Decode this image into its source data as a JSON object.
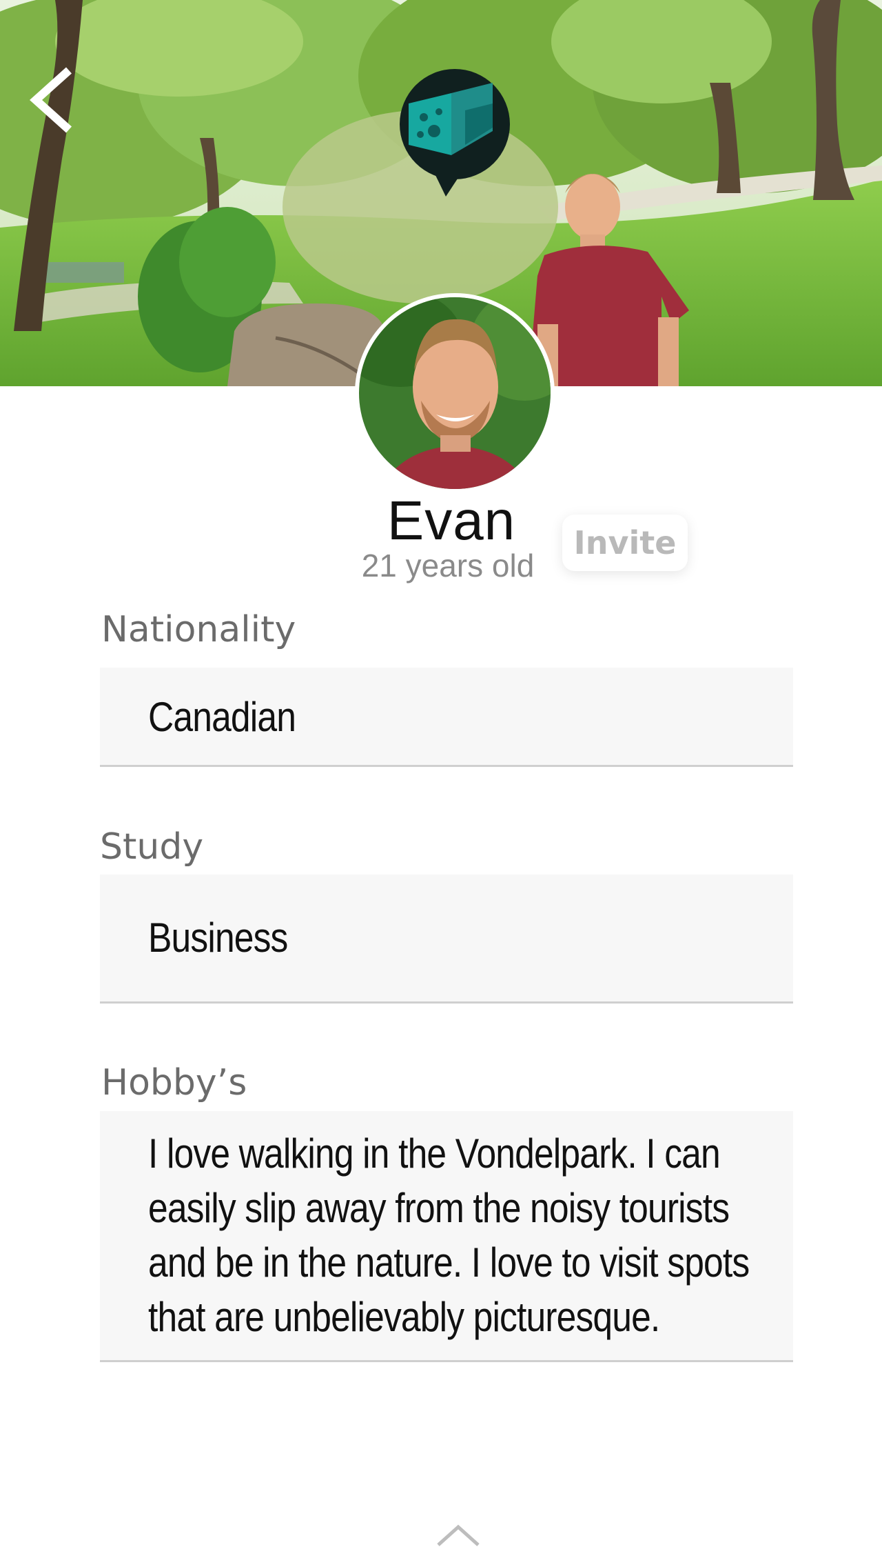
{
  "hero": {
    "back_icon": "chevron-left-icon",
    "logo_icon": "app-logo-icon"
  },
  "profile": {
    "name": "Evan",
    "age_text": "21 years old",
    "invite_label": "Invite"
  },
  "fields": {
    "nationality": {
      "label": "Nationality",
      "value": "Canadian"
    },
    "study": {
      "label": "Study",
      "value": "Business"
    },
    "hobbies": {
      "label": "Hobby’s",
      "value": "I love walking in the Vondelpark. I can easily slip away from the noisy tourists and be in the nature. I love to visit spots that are unbelievably picturesque."
    }
  },
  "footer": {
    "scroll_icon": "chevron-up-icon"
  },
  "colors": {
    "field_background": "#f7f7f7",
    "label_text": "#6b6b6b",
    "invite_text": "#b9b9b9"
  }
}
